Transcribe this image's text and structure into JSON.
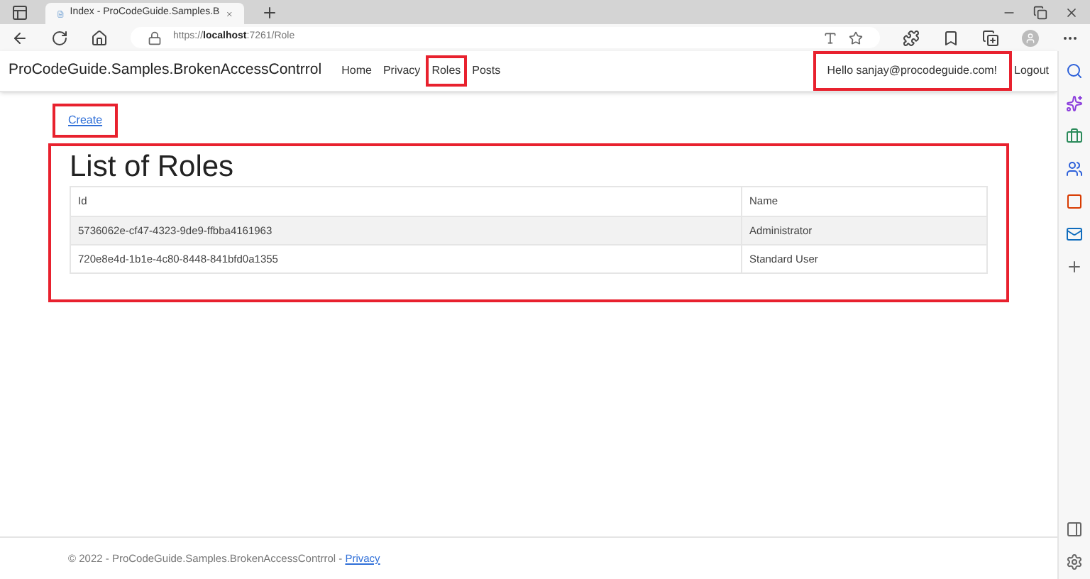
{
  "browser": {
    "tab_title": "Index - ProCodeGuide.Samples.B",
    "url_host": "localhost",
    "url_prefix": "https://",
    "url_rest": ":7261/Role"
  },
  "navbar": {
    "brand": "ProCodeGuide.Samples.BrokenAccessContrrol",
    "links": [
      {
        "label": "Home",
        "highlighted": false
      },
      {
        "label": "Privacy",
        "highlighted": false
      },
      {
        "label": "Roles",
        "highlighted": true
      },
      {
        "label": "Posts",
        "highlighted": false
      }
    ],
    "greeting": {
      "text": "Hello sanjay@procodeguide.com!",
      "highlighted": true
    },
    "logout": "Logout"
  },
  "create_link": {
    "label": "Create",
    "highlighted": true
  },
  "section": {
    "title": "List of Roles",
    "highlighted": true
  },
  "table": {
    "columns": [
      "Id",
      "Name"
    ],
    "rows": [
      {
        "cells": [
          "5736062e-cf47-4323-9de9-ffbba4161963",
          "Administrator"
        ]
      },
      {
        "cells": [
          "720e8e4d-1b1e-4c80-8448-841bfd0a1355",
          "Standard User"
        ]
      }
    ]
  },
  "footer": {
    "text": "© 2022 - ProCodeGuide.Samples.BrokenAccessContrrol - ",
    "link": "Privacy"
  }
}
